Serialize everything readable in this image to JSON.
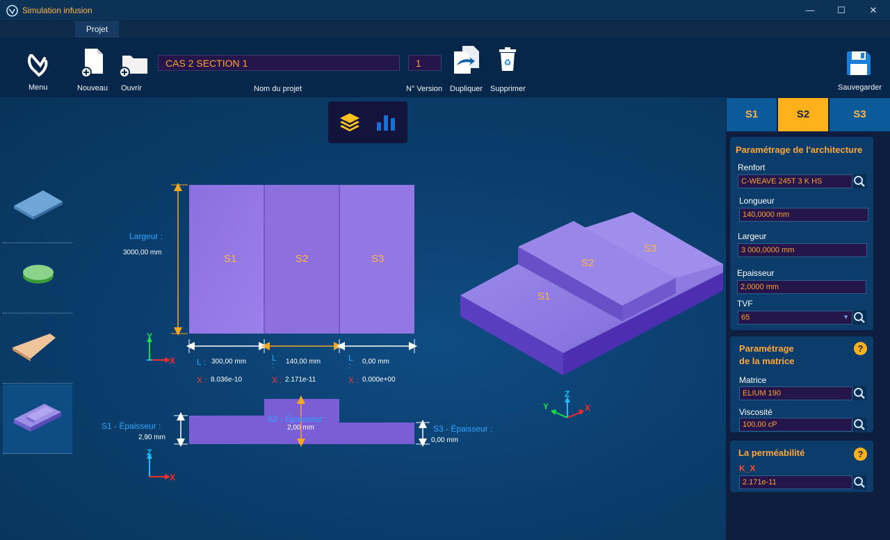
{
  "window": {
    "title": "Simulation infusion"
  },
  "menu_tabs": [
    {
      "label": "Projet"
    }
  ],
  "toolbar": {
    "menu_label": "Menu",
    "new_label": "Nouveau",
    "open_label": "Ouvrir",
    "project_name_value": "CAS 2 SECTION 1",
    "project_name_label": "Nom du projet",
    "version_value": "1",
    "version_label": "N° Version",
    "duplicate_label": "Dupliquer",
    "delete_label": "Supprimer",
    "save_label": "Sauvegarder"
  },
  "drawing": {
    "sections": [
      "S1",
      "S2",
      "S3"
    ],
    "largeur_label": "Largeur :",
    "largeur_value": "3000,00 mm",
    "lengths": [
      {
        "L": "L :",
        "value": "300,00 mm",
        "X": "X :",
        "x_value": "8.036e-10"
      },
      {
        "L": "L :",
        "value": "140,00 mm",
        "X": "X :",
        "x_value": "2.171e-11"
      },
      {
        "L": "L :",
        "value": "0,00 mm",
        "X": "X :",
        "x_value": "0.000e+00"
      }
    ],
    "thickness": [
      {
        "label": "S1 - Épaisseur :",
        "value": "2,90 mm"
      },
      {
        "label": "S2 - Épaisseur :",
        "value": "2,00 mm"
      },
      {
        "label": "S3 - Épaisseur :",
        "value": "0,00 mm"
      }
    ],
    "axes_top": {
      "y": "Y",
      "x": "X"
    },
    "axes_side": {
      "z": "Z",
      "x": "X"
    },
    "axes_3d": {
      "z": "Z",
      "y": "Y",
      "x": "X"
    }
  },
  "right_panel": {
    "section_tabs": [
      {
        "label": "S1"
      },
      {
        "label": "S2"
      },
      {
        "label": "S3"
      }
    ],
    "active_tab": "S2",
    "architecture": {
      "title": "Paramétrage de l'architecture",
      "renfort_label": "Renfort",
      "renfort_value": "C-WEAVE 245T 3 K HS",
      "longueur_label": "Longueur",
      "longueur_value": "140,0000 mm",
      "largeur_label": "Largeur",
      "largeur_value": "3 000,0000 mm",
      "epaisseur_label": "Epaisseur",
      "epaisseur_value": "2,0000 mm",
      "tvf_label": "TVF",
      "tvf_value": "65"
    },
    "matrix": {
      "title_line1": "Paramétrage",
      "title_line2": "de la matrice",
      "help": "?",
      "matrice_label": "Matrice",
      "matrice_value": "ELIUM 190",
      "viscosite_label": "Viscosité",
      "viscosite_value": "100,00 cP"
    },
    "permeability": {
      "title": "La perméabilité",
      "help": "?",
      "kx_label": "K_X",
      "kx_value": "2.171e-11"
    }
  },
  "colors": {
    "accent": "#ffb547",
    "active_tab": "#ffb11c",
    "part": "#8a6be0",
    "dimension_line": "#f5a623",
    "label_blue": "#2fa6ff",
    "x_red": "#ff3131"
  }
}
